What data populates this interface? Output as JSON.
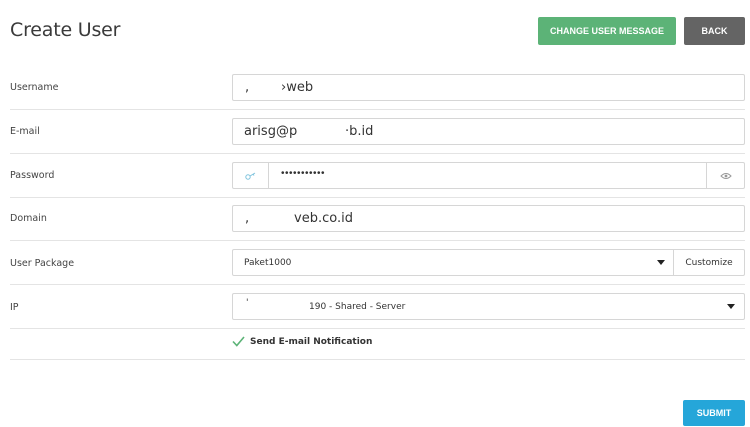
{
  "header": {
    "title": "Create User",
    "change_message_label": "CHANGE USER MESSAGE",
    "back_label": "BACK"
  },
  "form": {
    "username": {
      "label": "Username",
      "value_prefix": ",",
      "value": "›web"
    },
    "email": {
      "label": "E-mail",
      "value_prefix": "arisg@p",
      "value": "·b.id"
    },
    "password": {
      "label": "Password",
      "value": "•••••••••••"
    },
    "domain": {
      "label": "Domain",
      "value_prefix": ",",
      "value": "veb.co.id"
    },
    "package": {
      "label": "User Package",
      "value": "Paket1000",
      "customize_label": "Customize"
    },
    "ip": {
      "label": "IP",
      "value_prefix": "'",
      "value": "190 - Shared - Server"
    },
    "notification": {
      "label": "Send E-mail Notification",
      "checked": true
    }
  },
  "submit_label": "SUBMIT",
  "colors": {
    "green": "#5cb377",
    "gray": "#646464",
    "blue": "#25a6d9",
    "check": "#5cb377"
  }
}
